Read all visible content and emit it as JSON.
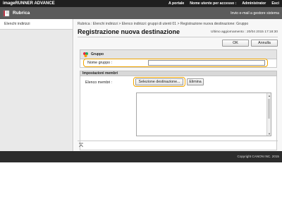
{
  "topbar": {
    "brand": "imageRUNNER ADVANCE",
    "portal": "A portale",
    "user_label": "Nome utente per accesso :",
    "user_name": "Administrator",
    "logout": "Esci"
  },
  "titlebar": {
    "title": "Rubrica",
    "send_settings": "Invio e-mail a gestore sistema"
  },
  "sidebar": {
    "items": [
      {
        "label": "Elenchi indirizzi"
      }
    ]
  },
  "breadcrumb": {
    "items": [
      "Rubrica : Elenchi indirizzi",
      "Elenco indirizzi: gruppi di utenti 01",
      "Registrazione nuova destinazione: Gruppo"
    ],
    "separator": ">"
  },
  "page": {
    "title": "Registrazione nuova destinazione",
    "updated": "Ultimo aggiornamento : 20/04 2015 17:18:30"
  },
  "buttons": {
    "ok": "OK",
    "cancel": "Annulla",
    "select_dest": "Selezione destinazione...",
    "delete": "Elimina"
  },
  "group": {
    "header": "Gruppo",
    "name_label": "Nome gruppo :",
    "name_value": ""
  },
  "members": {
    "header": "Impostazioni membri",
    "list_label": "Elenco membri :",
    "items": []
  },
  "footer": {
    "copyright": "Copyright CANON INC. 2015"
  },
  "colors": {
    "highlight": "#f0a500",
    "topbar": "#1f1f1f",
    "titlebar": "#5b5b5b"
  }
}
